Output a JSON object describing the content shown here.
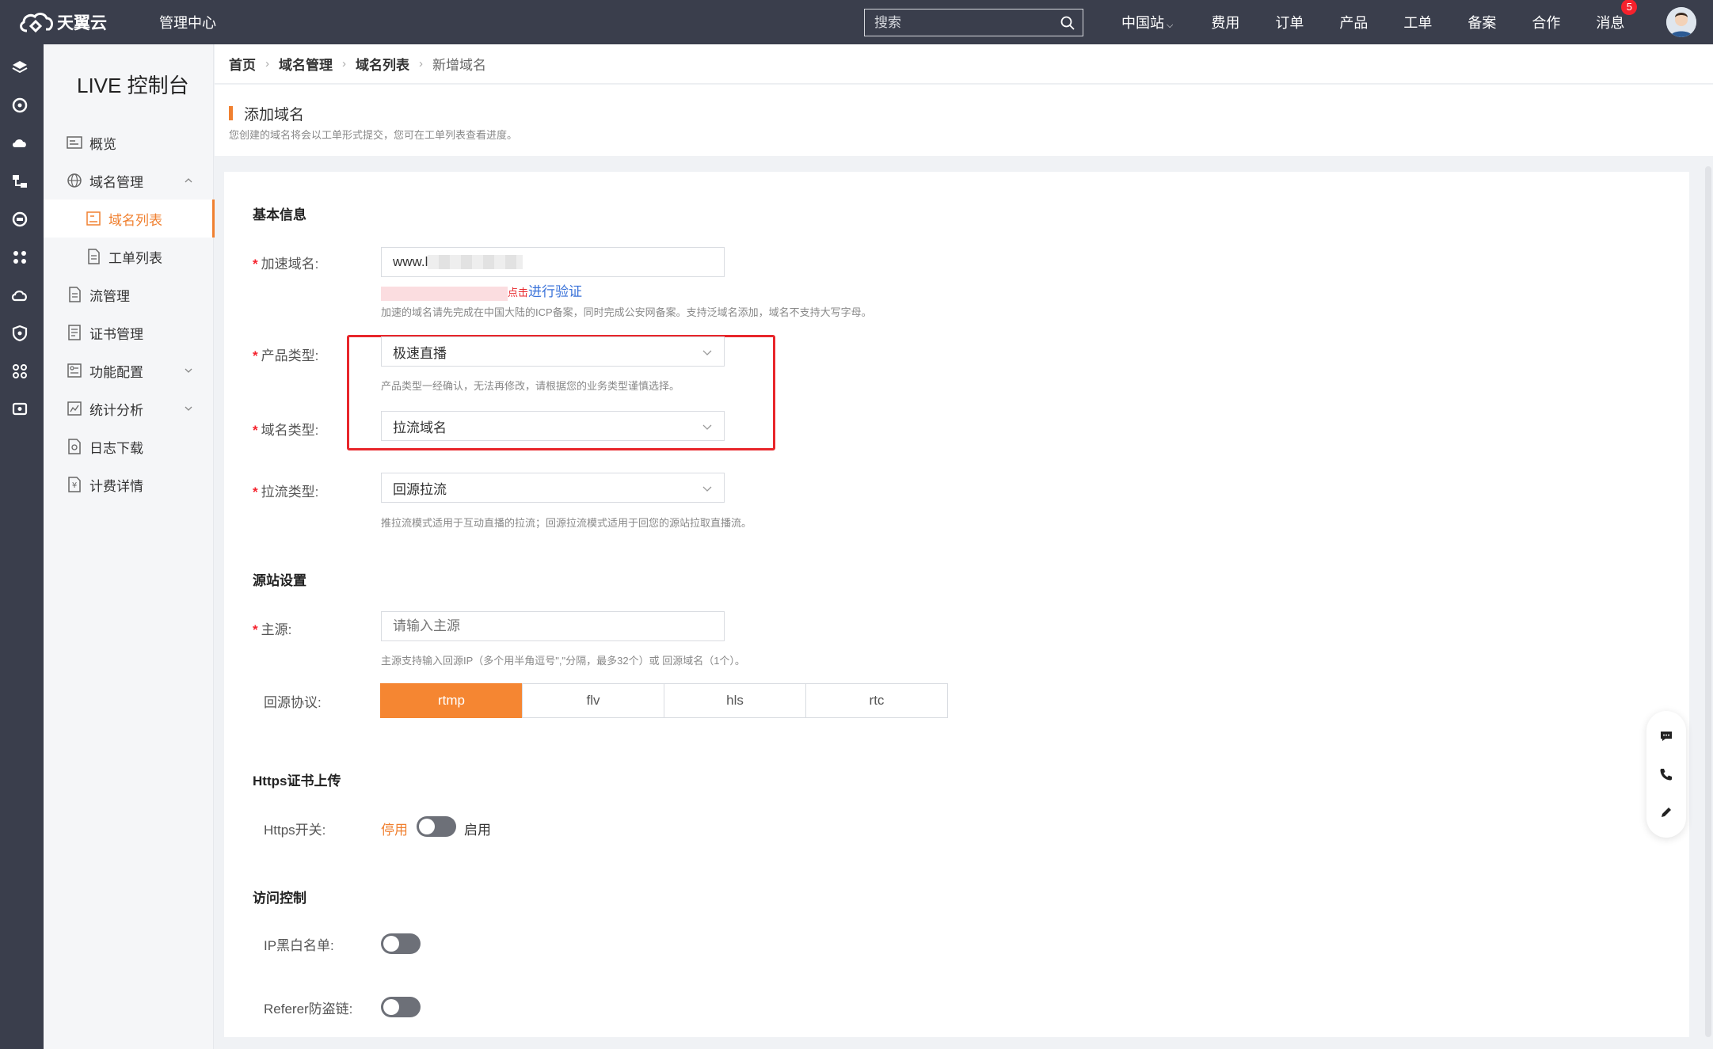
{
  "topbar": {
    "brand": "天翼云",
    "console": "管理中心",
    "search_placeholder": "搜索",
    "nav": [
      "中国站",
      "费用",
      "订单",
      "产品",
      "工单",
      "备案",
      "合作",
      "消息"
    ],
    "message_count": "5"
  },
  "sidebar": {
    "title": "LIVE 控制台",
    "items": [
      {
        "label": "概览",
        "icon": "overview-icon"
      },
      {
        "label": "域名管理",
        "icon": "globe-icon"
      },
      {
        "label": "域名列表",
        "icon": "domain-list-icon"
      },
      {
        "label": "工单列表",
        "icon": "document-icon"
      },
      {
        "label": "流管理",
        "icon": "document-icon"
      },
      {
        "label": "证书管理",
        "icon": "certificate-icon"
      },
      {
        "label": "功能配置",
        "icon": "config-icon"
      },
      {
        "label": "统计分析",
        "icon": "chart-icon"
      },
      {
        "label": "日志下载",
        "icon": "log-icon"
      },
      {
        "label": "计费详情",
        "icon": "billing-icon"
      }
    ]
  },
  "breadcrumb": [
    "首页",
    "域名管理",
    "域名列表",
    "新增域名"
  ],
  "page": {
    "title": "添加域名",
    "subtitle": "您创建的域名将会以工单形式提交，您可在工单列表查看进度。"
  },
  "form": {
    "section_basic": "基本信息",
    "domain_label": "加速域名:",
    "domain_value": "www.l",
    "verify_click": "点击",
    "verify_link": "进行验证",
    "domain_hint": "加速的域名请先完成在中国大陆的ICP备案，同时完成公安网备案。支持泛域名添加，域名不支持大写字母。",
    "product_label": "产品类型:",
    "product_value": "极速直播",
    "product_hint": "产品类型一经确认，无法再修改，请根据您的业务类型谨慎选择。",
    "domain_type_label": "域名类型:",
    "domain_type_value": "拉流域名",
    "pull_type_label": "拉流类型:",
    "pull_type_value": "回源拉流",
    "pull_type_hint": "推拉流模式适用于互动直播的拉流；回源拉流模式适用于回您的源站拉取直播流。",
    "section_origin": "源站设置",
    "origin_label": "主源:",
    "origin_placeholder": "请输入主源",
    "origin_hint": "主源支持输入回源IP（多个用半角逗号\",\"分隔，最多32个）或 回源域名（1个）。",
    "protocol_label": "回源协议:",
    "protocols": [
      "rtmp",
      "flv",
      "hls",
      "rtc"
    ],
    "protocol_selected": "rtmp",
    "section_https": "Https证书上传",
    "https_label": "Https开关:",
    "https_off": "停用",
    "https_on": "启用",
    "section_access": "访问控制",
    "ip_label": "IP黑白名单:",
    "referer_label": "Referer防盗链:"
  },
  "colors": {
    "accent": "#f58632",
    "topbar": "#3a3e4c",
    "highlight_box": "#e8262b"
  }
}
